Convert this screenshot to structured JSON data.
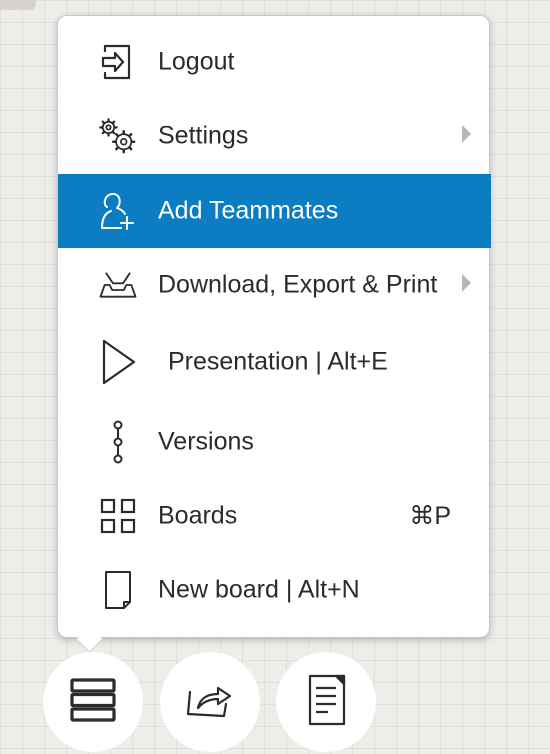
{
  "menu": {
    "items": [
      {
        "label": "Logout",
        "icon": "logout-icon"
      },
      {
        "label": "Settings",
        "icon": "gears-icon",
        "has_submenu": true
      },
      {
        "label": "Add Teammates",
        "icon": "add-user-icon",
        "active": true
      },
      {
        "label": "Download, Export & Print",
        "icon": "tray-download-icon",
        "has_submenu": true
      },
      {
        "label": "Presentation | Alt+E",
        "icon": "play-icon"
      },
      {
        "label": "Versions",
        "icon": "versions-icon"
      },
      {
        "label": "Boards",
        "icon": "grid-icon",
        "shortcut": "⌘P"
      },
      {
        "label": "New board | Alt+N",
        "icon": "document-icon"
      }
    ]
  },
  "toolbar": {
    "buttons": [
      {
        "icon": "menu-stack-icon"
      },
      {
        "icon": "share-icon"
      },
      {
        "icon": "notes-icon"
      }
    ]
  },
  "colors": {
    "active": "#0c7dc2",
    "background": "#efedea",
    "text": "#2b2b2b"
  }
}
